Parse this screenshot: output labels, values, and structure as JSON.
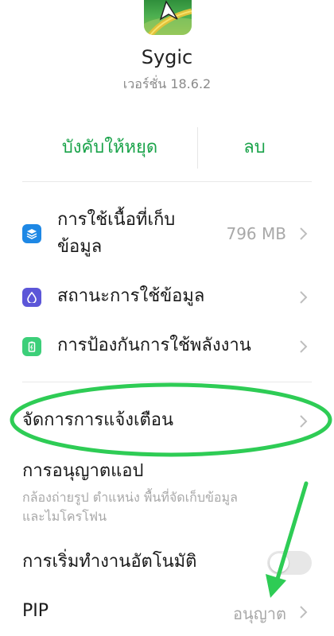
{
  "app": {
    "name": "Sygic",
    "version": "เวอร์ชั่น 18.6.2",
    "icon": "navigation-arrow-icon"
  },
  "actions": {
    "force_stop": "บังคับให้หยุด",
    "delete": "ลบ"
  },
  "settings": {
    "storage": {
      "label_line1": "การใช้เนื้อที่เก็บ",
      "label_line2": "ข้อมูล",
      "value": "796 MB",
      "icon": "layers-icon",
      "icon_color": "#1e88e5"
    },
    "data_usage": {
      "label": "สถานะการใช้ข้อมูล",
      "icon": "droplet-icon",
      "icon_color": "#5c56d8"
    },
    "battery": {
      "label": "การป้องกันการใช้พลังงาน",
      "icon": "battery-icon",
      "icon_color": "#3ccf79"
    },
    "notifications": {
      "label": "จัดการการแจ้งเตือน"
    },
    "permissions": {
      "label": "การอนุญาตแอป",
      "sub_line1": "กล้องถ่ายรูป ตำแหน่ง พื้นที่จัดเก็บข้อมูล",
      "sub_line2": "และไมโครโฟน"
    },
    "autostart": {
      "label": "การเริ่มทำงานอัตโนมัติ",
      "enabled": false
    },
    "pip": {
      "label": "PIP",
      "value": "อนุญาต"
    }
  },
  "annotation_color": "#2ecc55"
}
